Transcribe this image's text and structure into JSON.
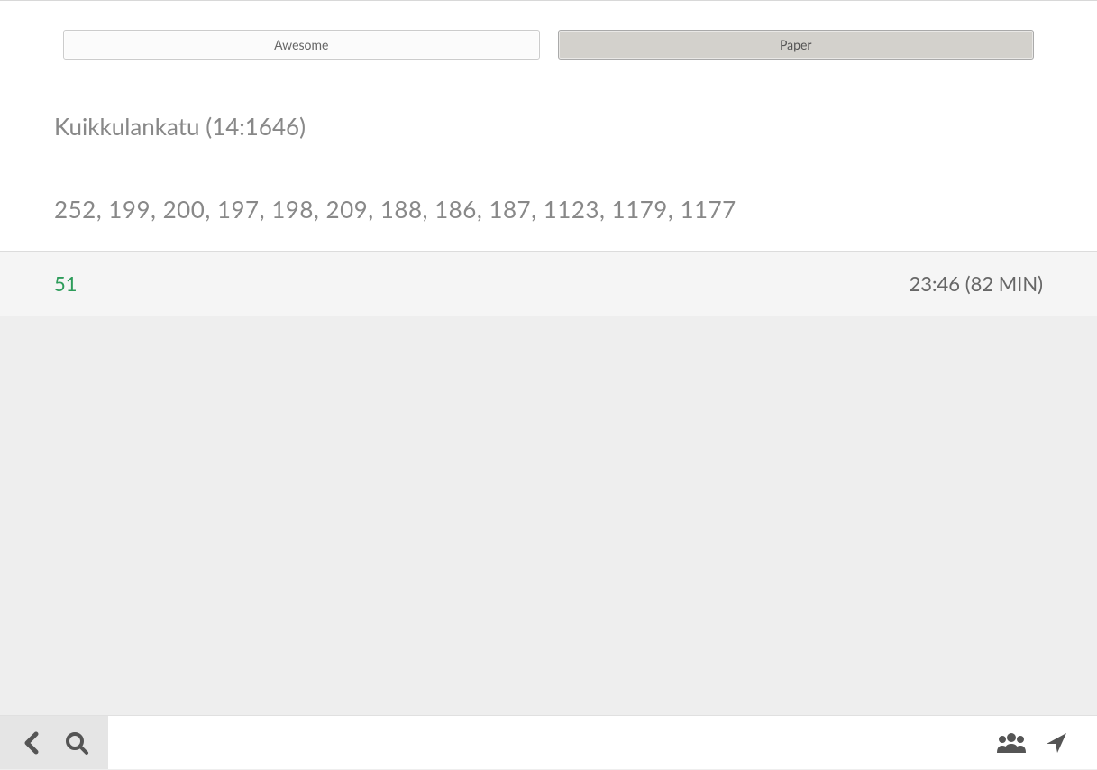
{
  "tabs": {
    "left": {
      "label": "Awesome"
    },
    "right": {
      "label": "Paper"
    }
  },
  "header": {
    "title": "Kuikkulankatu (14:1646)"
  },
  "numbers": {
    "list": "252,  199,  200,  197,  198,  209,  188,  186,  187,  1123,  1179,  1177"
  },
  "row": {
    "id": "51",
    "time": "23:46  (82 MIN)"
  }
}
